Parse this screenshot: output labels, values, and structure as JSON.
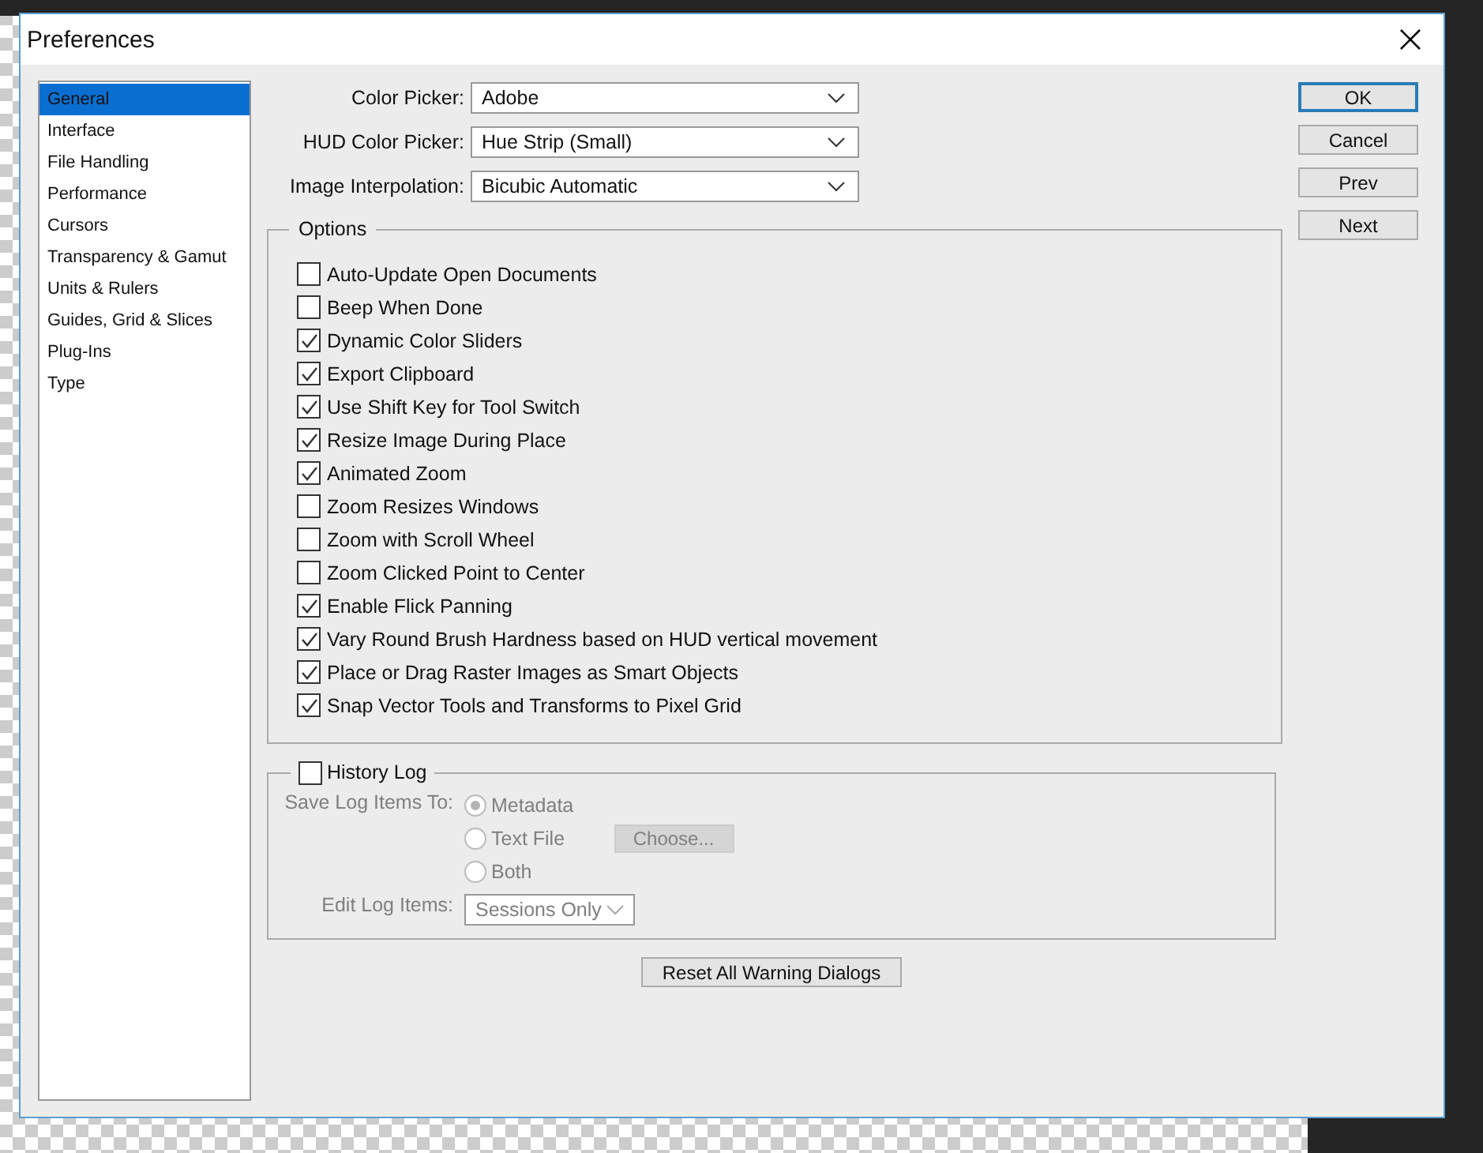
{
  "window": {
    "title": "Preferences"
  },
  "sidebar": {
    "items": [
      {
        "label": "General",
        "selected": true
      },
      {
        "label": "Interface",
        "selected": false
      },
      {
        "label": "File Handling",
        "selected": false
      },
      {
        "label": "Performance",
        "selected": false
      },
      {
        "label": "Cursors",
        "selected": false
      },
      {
        "label": "Transparency & Gamut",
        "selected": false
      },
      {
        "label": "Units & Rulers",
        "selected": false
      },
      {
        "label": "Guides, Grid & Slices",
        "selected": false
      },
      {
        "label": "Plug-Ins",
        "selected": false
      },
      {
        "label": "Type",
        "selected": false
      }
    ]
  },
  "dropdowns": [
    {
      "label": "Color Picker:",
      "value": "Adobe"
    },
    {
      "label": "HUD Color Picker:",
      "value": "Hue Strip (Small)"
    },
    {
      "label": "Image Interpolation:",
      "value": "Bicubic Automatic"
    }
  ],
  "options": {
    "title": "Options",
    "items": [
      {
        "label": "Auto-Update Open Documents",
        "checked": false
      },
      {
        "label": "Beep When Done",
        "checked": false
      },
      {
        "label": "Dynamic Color Sliders",
        "checked": true
      },
      {
        "label": "Export Clipboard",
        "checked": true
      },
      {
        "label": "Use Shift Key for Tool Switch",
        "checked": true
      },
      {
        "label": "Resize Image During Place",
        "checked": true
      },
      {
        "label": "Animated Zoom",
        "checked": true
      },
      {
        "label": "Zoom Resizes Windows",
        "checked": false
      },
      {
        "label": "Zoom with Scroll Wheel",
        "checked": false
      },
      {
        "label": "Zoom Clicked Point to Center",
        "checked": false
      },
      {
        "label": "Enable Flick Panning",
        "checked": true
      },
      {
        "label": "Vary Round Brush Hardness based on HUD vertical movement",
        "checked": true
      },
      {
        "label": "Place or Drag Raster Images as Smart Objects",
        "checked": true
      },
      {
        "label": "Snap Vector Tools and Transforms to Pixel Grid",
        "checked": true
      }
    ]
  },
  "history_log": {
    "label": "History Log",
    "checked": false,
    "save_label": "Save Log Items To:",
    "save_options": [
      {
        "label": "Metadata",
        "selected": true
      },
      {
        "label": "Text File",
        "selected": false
      },
      {
        "label": "Both",
        "selected": false
      }
    ],
    "choose_button": "Choose...",
    "edit_label": "Edit Log Items:",
    "edit_value": "Sessions Only"
  },
  "reset_button": "Reset All Warning Dialogs",
  "buttons": [
    {
      "label": "OK",
      "default": true
    },
    {
      "label": "Cancel",
      "default": false
    },
    {
      "label": "Prev",
      "default": false
    },
    {
      "label": "Next",
      "default": false
    }
  ]
}
